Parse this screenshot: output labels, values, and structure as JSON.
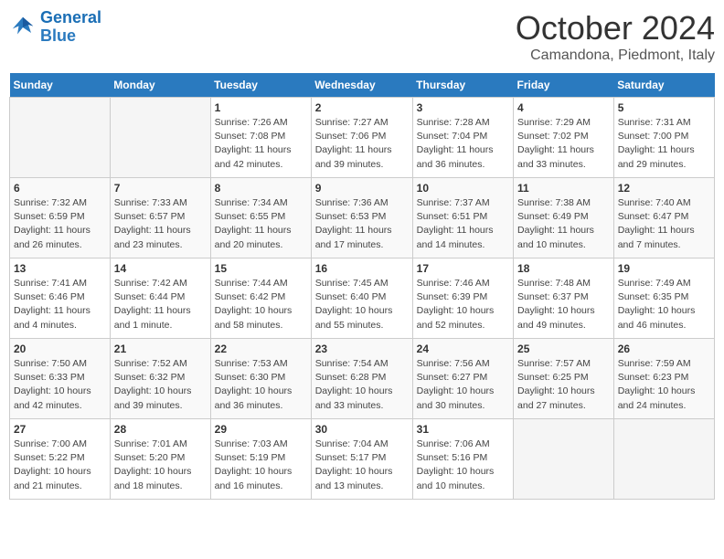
{
  "header": {
    "logo_general": "General",
    "logo_blue": "Blue",
    "month": "October 2024",
    "location": "Camandona, Piedmont, Italy"
  },
  "weekdays": [
    "Sunday",
    "Monday",
    "Tuesday",
    "Wednesday",
    "Thursday",
    "Friday",
    "Saturday"
  ],
  "weeks": [
    [
      {
        "day": "",
        "info": ""
      },
      {
        "day": "",
        "info": ""
      },
      {
        "day": "1",
        "info": "Sunrise: 7:26 AM\nSunset: 7:08 PM\nDaylight: 11 hours and 42 minutes."
      },
      {
        "day": "2",
        "info": "Sunrise: 7:27 AM\nSunset: 7:06 PM\nDaylight: 11 hours and 39 minutes."
      },
      {
        "day": "3",
        "info": "Sunrise: 7:28 AM\nSunset: 7:04 PM\nDaylight: 11 hours and 36 minutes."
      },
      {
        "day": "4",
        "info": "Sunrise: 7:29 AM\nSunset: 7:02 PM\nDaylight: 11 hours and 33 minutes."
      },
      {
        "day": "5",
        "info": "Sunrise: 7:31 AM\nSunset: 7:00 PM\nDaylight: 11 hours and 29 minutes."
      }
    ],
    [
      {
        "day": "6",
        "info": "Sunrise: 7:32 AM\nSunset: 6:59 PM\nDaylight: 11 hours and 26 minutes."
      },
      {
        "day": "7",
        "info": "Sunrise: 7:33 AM\nSunset: 6:57 PM\nDaylight: 11 hours and 23 minutes."
      },
      {
        "day": "8",
        "info": "Sunrise: 7:34 AM\nSunset: 6:55 PM\nDaylight: 11 hours and 20 minutes."
      },
      {
        "day": "9",
        "info": "Sunrise: 7:36 AM\nSunset: 6:53 PM\nDaylight: 11 hours and 17 minutes."
      },
      {
        "day": "10",
        "info": "Sunrise: 7:37 AM\nSunset: 6:51 PM\nDaylight: 11 hours and 14 minutes."
      },
      {
        "day": "11",
        "info": "Sunrise: 7:38 AM\nSunset: 6:49 PM\nDaylight: 11 hours and 10 minutes."
      },
      {
        "day": "12",
        "info": "Sunrise: 7:40 AM\nSunset: 6:47 PM\nDaylight: 11 hours and 7 minutes."
      }
    ],
    [
      {
        "day": "13",
        "info": "Sunrise: 7:41 AM\nSunset: 6:46 PM\nDaylight: 11 hours and 4 minutes."
      },
      {
        "day": "14",
        "info": "Sunrise: 7:42 AM\nSunset: 6:44 PM\nDaylight: 11 hours and 1 minute."
      },
      {
        "day": "15",
        "info": "Sunrise: 7:44 AM\nSunset: 6:42 PM\nDaylight: 10 hours and 58 minutes."
      },
      {
        "day": "16",
        "info": "Sunrise: 7:45 AM\nSunset: 6:40 PM\nDaylight: 10 hours and 55 minutes."
      },
      {
        "day": "17",
        "info": "Sunrise: 7:46 AM\nSunset: 6:39 PM\nDaylight: 10 hours and 52 minutes."
      },
      {
        "day": "18",
        "info": "Sunrise: 7:48 AM\nSunset: 6:37 PM\nDaylight: 10 hours and 49 minutes."
      },
      {
        "day": "19",
        "info": "Sunrise: 7:49 AM\nSunset: 6:35 PM\nDaylight: 10 hours and 46 minutes."
      }
    ],
    [
      {
        "day": "20",
        "info": "Sunrise: 7:50 AM\nSunset: 6:33 PM\nDaylight: 10 hours and 42 minutes."
      },
      {
        "day": "21",
        "info": "Sunrise: 7:52 AM\nSunset: 6:32 PM\nDaylight: 10 hours and 39 minutes."
      },
      {
        "day": "22",
        "info": "Sunrise: 7:53 AM\nSunset: 6:30 PM\nDaylight: 10 hours and 36 minutes."
      },
      {
        "day": "23",
        "info": "Sunrise: 7:54 AM\nSunset: 6:28 PM\nDaylight: 10 hours and 33 minutes."
      },
      {
        "day": "24",
        "info": "Sunrise: 7:56 AM\nSunset: 6:27 PM\nDaylight: 10 hours and 30 minutes."
      },
      {
        "day": "25",
        "info": "Sunrise: 7:57 AM\nSunset: 6:25 PM\nDaylight: 10 hours and 27 minutes."
      },
      {
        "day": "26",
        "info": "Sunrise: 7:59 AM\nSunset: 6:23 PM\nDaylight: 10 hours and 24 minutes."
      }
    ],
    [
      {
        "day": "27",
        "info": "Sunrise: 7:00 AM\nSunset: 5:22 PM\nDaylight: 10 hours and 21 minutes."
      },
      {
        "day": "28",
        "info": "Sunrise: 7:01 AM\nSunset: 5:20 PM\nDaylight: 10 hours and 18 minutes."
      },
      {
        "day": "29",
        "info": "Sunrise: 7:03 AM\nSunset: 5:19 PM\nDaylight: 10 hours and 16 minutes."
      },
      {
        "day": "30",
        "info": "Sunrise: 7:04 AM\nSunset: 5:17 PM\nDaylight: 10 hours and 13 minutes."
      },
      {
        "day": "31",
        "info": "Sunrise: 7:06 AM\nSunset: 5:16 PM\nDaylight: 10 hours and 10 minutes."
      },
      {
        "day": "",
        "info": ""
      },
      {
        "day": "",
        "info": ""
      }
    ]
  ]
}
